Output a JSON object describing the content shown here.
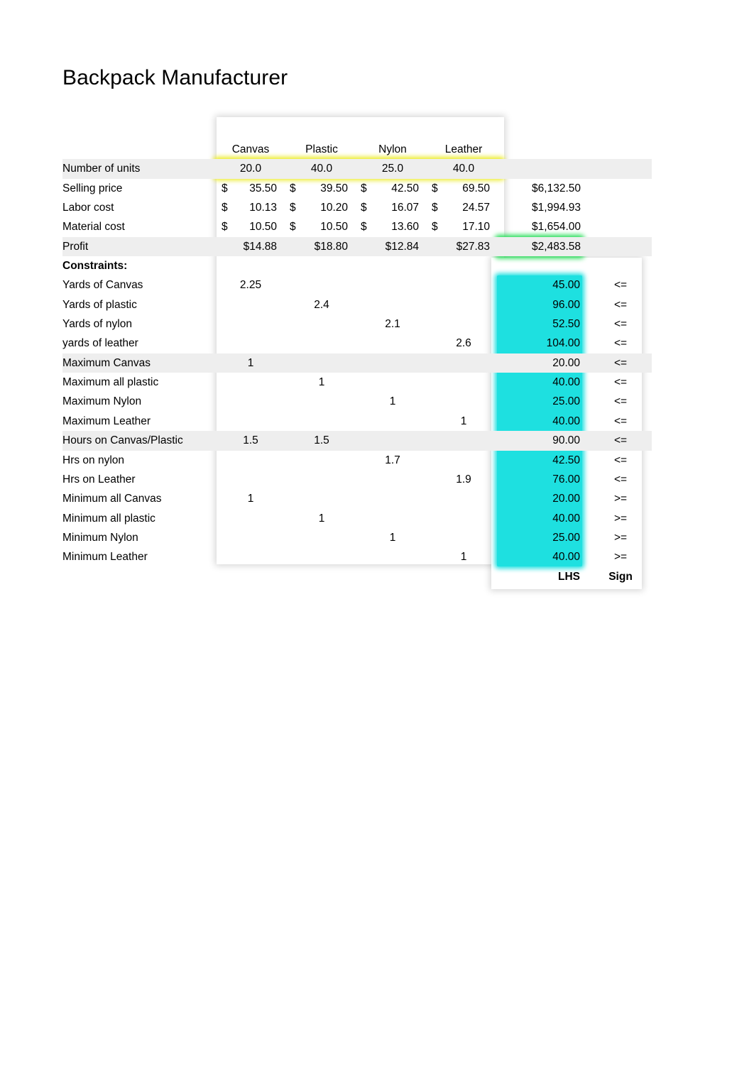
{
  "title": "Backpack Manufacturer",
  "colors": {
    "highlight_yellow": "#ECEC22",
    "highlight_green": "#22DD55",
    "highlight_cyan": "#1EE0E0",
    "band_gray": "#EEEEEE"
  },
  "table": {
    "column_headers": [
      "Canvas",
      "Plastic",
      "Nylon",
      "Leather"
    ],
    "currency_symbol": "$",
    "rows": [
      {
        "label": "Number of units",
        "values": [
          "20.0",
          "40.0",
          "25.0",
          "40.0"
        ],
        "total": ""
      },
      {
        "label": "Selling price",
        "values": [
          "35.50",
          "39.50",
          "42.50",
          "69.50"
        ],
        "total": "$6,132.50"
      },
      {
        "label": "Labor cost",
        "values": [
          "10.13",
          "10.20",
          "16.07",
          "24.57"
        ],
        "total": "$1,994.93"
      },
      {
        "label": "Material cost",
        "values": [
          "10.50",
          "10.50",
          "13.60",
          "17.10"
        ],
        "total": "$1,654.00"
      },
      {
        "label": "Profit",
        "values": [
          "$14.88",
          "$18.80",
          "$12.84",
          "$27.83"
        ],
        "total": "$2,483.58"
      }
    ]
  },
  "constraints_header": "Constraints:",
  "constraints": [
    {
      "label": "Yards of Canvas",
      "coeffs": [
        "2.25",
        "",
        "",
        ""
      ],
      "lhs": "45.00",
      "sign": "<="
    },
    {
      "label": "Yards of plastic",
      "coeffs": [
        "",
        "2.4",
        "",
        ""
      ],
      "lhs": "96.00",
      "sign": "<="
    },
    {
      "label": "Yards of nylon",
      "coeffs": [
        "",
        "",
        "2.1",
        ""
      ],
      "lhs": "52.50",
      "sign": "<="
    },
    {
      "label": "yards of leather",
      "coeffs": [
        "",
        "",
        "",
        "2.6"
      ],
      "lhs": "104.00",
      "sign": "<="
    },
    {
      "label": "Maximum Canvas",
      "coeffs": [
        "1",
        "",
        "",
        ""
      ],
      "lhs": "20.00",
      "sign": "<="
    },
    {
      "label": "Maximum all plastic",
      "coeffs": [
        "",
        "1",
        "",
        ""
      ],
      "lhs": "40.00",
      "sign": "<="
    },
    {
      "label": "Maximum Nylon",
      "coeffs": [
        "",
        "",
        "1",
        ""
      ],
      "lhs": "25.00",
      "sign": "<="
    },
    {
      "label": "Maximum Leather",
      "coeffs": [
        "",
        "",
        "",
        "1"
      ],
      "lhs": "40.00",
      "sign": "<="
    },
    {
      "label": "Hours on Canvas/Plastic",
      "coeffs": [
        "1.5",
        "1.5",
        "",
        ""
      ],
      "lhs": "90.00",
      "sign": "<="
    },
    {
      "label": "Hrs on nylon",
      "coeffs": [
        "",
        "",
        "1.7",
        ""
      ],
      "lhs": "42.50",
      "sign": "<="
    },
    {
      "label": "Hrs on Leather",
      "coeffs": [
        "",
        "",
        "",
        "1.9"
      ],
      "lhs": "76.00",
      "sign": "<="
    },
    {
      "label": "Minimum all Canvas",
      "coeffs": [
        "1",
        "",
        "",
        ""
      ],
      "lhs": "20.00",
      "sign": ">="
    },
    {
      "label": "Minimum all plastic",
      "coeffs": [
        "",
        "1",
        "",
        ""
      ],
      "lhs": "40.00",
      "sign": ">="
    },
    {
      "label": "Minimum Nylon",
      "coeffs": [
        "",
        "",
        "1",
        ""
      ],
      "lhs": "25.00",
      "sign": ">="
    },
    {
      "label": "Minimum Leather",
      "coeffs": [
        "",
        "",
        "",
        "1"
      ],
      "lhs": "40.00",
      "sign": ">="
    }
  ],
  "footer": {
    "lhs_label": "LHS",
    "sign_label": "Sign"
  }
}
